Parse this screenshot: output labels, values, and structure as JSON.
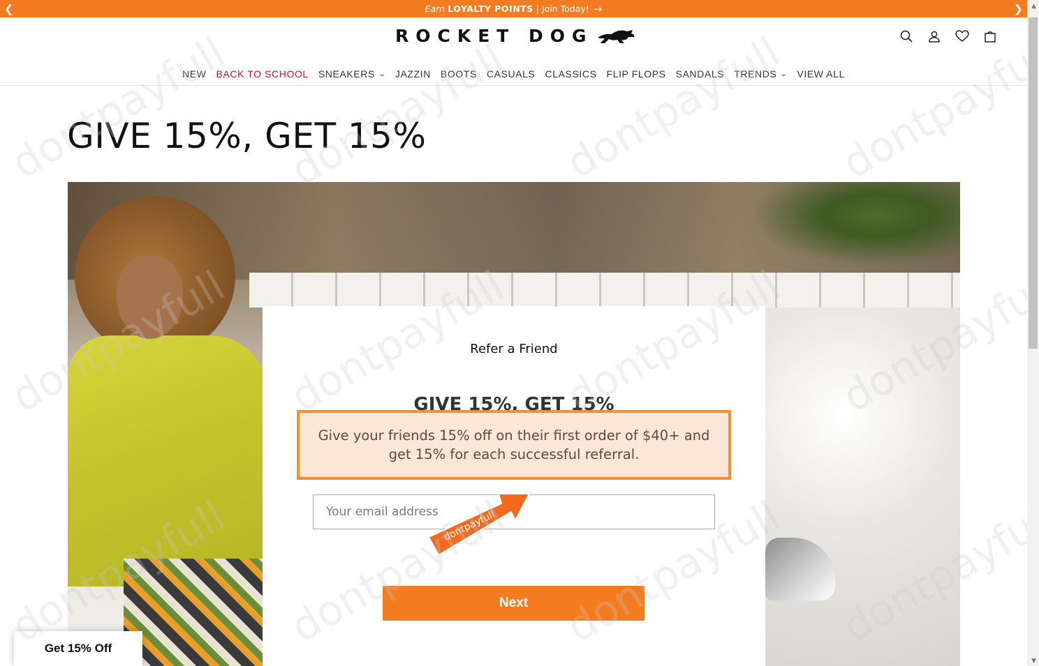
{
  "announcement": {
    "prefix": "Earn",
    "bold": "LOYALTY POINTS",
    "separator": "|",
    "link": "Join Today!",
    "prev_icon": "chevron-left-icon",
    "next_icon": "chevron-right-icon",
    "arrow_icon": "arrow-right-icon",
    "color": "#f47c20"
  },
  "header": {
    "logo_text": "ROCKET DOG",
    "logo_icon": "running-dog-icon",
    "icons": [
      "search-icon",
      "account-icon",
      "heart-icon",
      "cart-icon"
    ]
  },
  "nav": {
    "items": [
      {
        "label": "NEW"
      },
      {
        "label": "BACK TO SCHOOL"
      },
      {
        "label": "SNEAKERS"
      },
      {
        "label": "JAZZIN"
      },
      {
        "label": "BOOTS"
      },
      {
        "label": "CASUALS"
      },
      {
        "label": "CLASSICS"
      },
      {
        "label": "FLIP FLOPS"
      },
      {
        "label": "SANDALS"
      },
      {
        "label": "TRENDS"
      },
      {
        "label": "VIEW ALL"
      }
    ],
    "highlight_color": "#c8102e"
  },
  "page": {
    "title": "GIVE 15%, GET 15%"
  },
  "card": {
    "eyebrow": "Refer a Friend",
    "heading": "GIVE 15%, GET 15%",
    "description": "Give your friends 15% off on their first order of $40+ and get 15% for each successful referral.",
    "email_placeholder": "Your email address",
    "next_label": "Next"
  },
  "stamp": {
    "text": "dontpayfull"
  },
  "float_tab": {
    "label": "Get 15% Off"
  },
  "watermark": {
    "text": "dontpayfull"
  }
}
